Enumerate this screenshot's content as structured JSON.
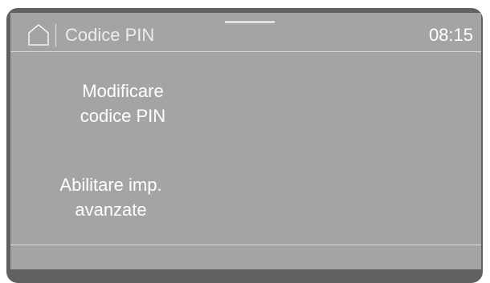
{
  "header": {
    "home_icon": "home-icon",
    "title": "Codice PIN",
    "time": "08:15"
  },
  "menu": {
    "items": [
      {
        "line1": "Modificare",
        "line2": "codice PIN"
      },
      {
        "line1": "Abilitare imp.",
        "line2": "avanzate"
      }
    ]
  },
  "colors": {
    "bezel": "#616161",
    "screen": "#a4a4a4",
    "text": "#ffffff",
    "divider": "#d9d9d9"
  }
}
